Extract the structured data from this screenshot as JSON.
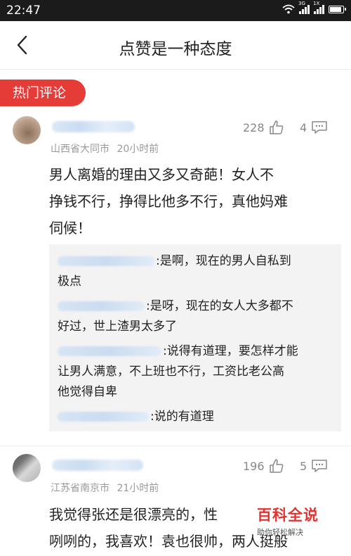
{
  "status": {
    "time": "22:47",
    "network": "3G",
    "sim": "1X"
  },
  "nav": {
    "title": "点赞是一种态度"
  },
  "section": {
    "hot_label": "热门评论"
  },
  "comments": [
    {
      "likes": "228",
      "replies": "4",
      "location": "山西省大同市",
      "time": "20小时前",
      "lines": [
        "男人离婚的理由又多又奇葩！女人不",
        "挣钱不行，挣得比他多不行，真他妈难",
        "伺候！"
      ],
      "reply_items": [
        ":是啊，现在的男人自私到",
        "极点",
        ":是呀，现在的女人大多都不",
        "好过，世上渣男太多了",
        ":说得有道理，要怎样才能",
        "让男人满意，不上班也不行，工资比老公高",
        "他觉得自卑",
        ":说的有道理"
      ]
    },
    {
      "likes": "196",
      "replies": "5",
      "location": "江苏省南京市",
      "time": "21小时前",
      "lines": [
        "我觉得张还是很漂亮的，性",
        "咧咧的，我喜欢！袁也很帅，两人挺般"
      ]
    }
  ],
  "watermark": {
    "title": "百科全说",
    "subtitle": "助你轻松解决"
  },
  "colors": {
    "accent": "#e53c38",
    "meta": "#999999",
    "reply_bg": "#f3f3f3"
  }
}
